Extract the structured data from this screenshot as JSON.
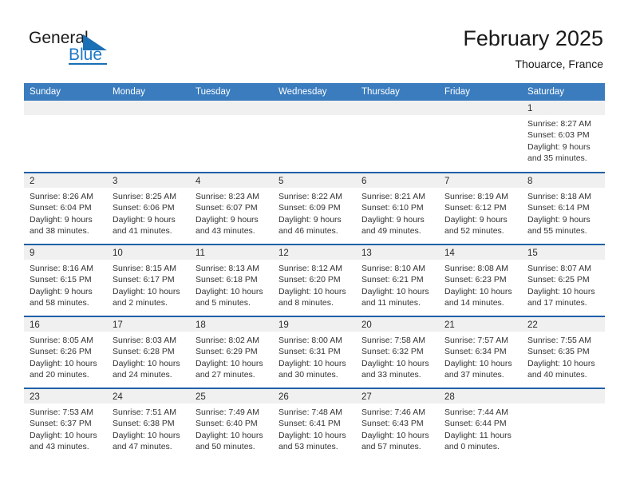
{
  "brand": {
    "name_part1": "General",
    "name_part2": "Blue",
    "accent_color": "#1A6FB5"
  },
  "header": {
    "title": "February 2025",
    "subtitle": "Thouarce, France"
  },
  "theme": {
    "header_blue": "#3A7CBE",
    "divider_blue": "#1F60A8",
    "day_band_gray": "#F0F0F0"
  },
  "calendar": {
    "weekdays": [
      "Sunday",
      "Monday",
      "Tuesday",
      "Wednesday",
      "Thursday",
      "Friday",
      "Saturday"
    ],
    "weeks": [
      [
        {
          "day": "",
          "lines": []
        },
        {
          "day": "",
          "lines": []
        },
        {
          "day": "",
          "lines": []
        },
        {
          "day": "",
          "lines": []
        },
        {
          "day": "",
          "lines": []
        },
        {
          "day": "",
          "lines": []
        },
        {
          "day": "1",
          "lines": [
            "Sunrise: 8:27 AM",
            "Sunset: 6:03 PM",
            "Daylight: 9 hours",
            "and 35 minutes."
          ]
        }
      ],
      [
        {
          "day": "2",
          "lines": [
            "Sunrise: 8:26 AM",
            "Sunset: 6:04 PM",
            "Daylight: 9 hours",
            "and 38 minutes."
          ]
        },
        {
          "day": "3",
          "lines": [
            "Sunrise: 8:25 AM",
            "Sunset: 6:06 PM",
            "Daylight: 9 hours",
            "and 41 minutes."
          ]
        },
        {
          "day": "4",
          "lines": [
            "Sunrise: 8:23 AM",
            "Sunset: 6:07 PM",
            "Daylight: 9 hours",
            "and 43 minutes."
          ]
        },
        {
          "day": "5",
          "lines": [
            "Sunrise: 8:22 AM",
            "Sunset: 6:09 PM",
            "Daylight: 9 hours",
            "and 46 minutes."
          ]
        },
        {
          "day": "6",
          "lines": [
            "Sunrise: 8:21 AM",
            "Sunset: 6:10 PM",
            "Daylight: 9 hours",
            "and 49 minutes."
          ]
        },
        {
          "day": "7",
          "lines": [
            "Sunrise: 8:19 AM",
            "Sunset: 6:12 PM",
            "Daylight: 9 hours",
            "and 52 minutes."
          ]
        },
        {
          "day": "8",
          "lines": [
            "Sunrise: 8:18 AM",
            "Sunset: 6:14 PM",
            "Daylight: 9 hours",
            "and 55 minutes."
          ]
        }
      ],
      [
        {
          "day": "9",
          "lines": [
            "Sunrise: 8:16 AM",
            "Sunset: 6:15 PM",
            "Daylight: 9 hours",
            "and 58 minutes."
          ]
        },
        {
          "day": "10",
          "lines": [
            "Sunrise: 8:15 AM",
            "Sunset: 6:17 PM",
            "Daylight: 10 hours",
            "and 2 minutes."
          ]
        },
        {
          "day": "11",
          "lines": [
            "Sunrise: 8:13 AM",
            "Sunset: 6:18 PM",
            "Daylight: 10 hours",
            "and 5 minutes."
          ]
        },
        {
          "day": "12",
          "lines": [
            "Sunrise: 8:12 AM",
            "Sunset: 6:20 PM",
            "Daylight: 10 hours",
            "and 8 minutes."
          ]
        },
        {
          "day": "13",
          "lines": [
            "Sunrise: 8:10 AM",
            "Sunset: 6:21 PM",
            "Daylight: 10 hours",
            "and 11 minutes."
          ]
        },
        {
          "day": "14",
          "lines": [
            "Sunrise: 8:08 AM",
            "Sunset: 6:23 PM",
            "Daylight: 10 hours",
            "and 14 minutes."
          ]
        },
        {
          "day": "15",
          "lines": [
            "Sunrise: 8:07 AM",
            "Sunset: 6:25 PM",
            "Daylight: 10 hours",
            "and 17 minutes."
          ]
        }
      ],
      [
        {
          "day": "16",
          "lines": [
            "Sunrise: 8:05 AM",
            "Sunset: 6:26 PM",
            "Daylight: 10 hours",
            "and 20 minutes."
          ]
        },
        {
          "day": "17",
          "lines": [
            "Sunrise: 8:03 AM",
            "Sunset: 6:28 PM",
            "Daylight: 10 hours",
            "and 24 minutes."
          ]
        },
        {
          "day": "18",
          "lines": [
            "Sunrise: 8:02 AM",
            "Sunset: 6:29 PM",
            "Daylight: 10 hours",
            "and 27 minutes."
          ]
        },
        {
          "day": "19",
          "lines": [
            "Sunrise: 8:00 AM",
            "Sunset: 6:31 PM",
            "Daylight: 10 hours",
            "and 30 minutes."
          ]
        },
        {
          "day": "20",
          "lines": [
            "Sunrise: 7:58 AM",
            "Sunset: 6:32 PM",
            "Daylight: 10 hours",
            "and 33 minutes."
          ]
        },
        {
          "day": "21",
          "lines": [
            "Sunrise: 7:57 AM",
            "Sunset: 6:34 PM",
            "Daylight: 10 hours",
            "and 37 minutes."
          ]
        },
        {
          "day": "22",
          "lines": [
            "Sunrise: 7:55 AM",
            "Sunset: 6:35 PM",
            "Daylight: 10 hours",
            "and 40 minutes."
          ]
        }
      ],
      [
        {
          "day": "23",
          "lines": [
            "Sunrise: 7:53 AM",
            "Sunset: 6:37 PM",
            "Daylight: 10 hours",
            "and 43 minutes."
          ]
        },
        {
          "day": "24",
          "lines": [
            "Sunrise: 7:51 AM",
            "Sunset: 6:38 PM",
            "Daylight: 10 hours",
            "and 47 minutes."
          ]
        },
        {
          "day": "25",
          "lines": [
            "Sunrise: 7:49 AM",
            "Sunset: 6:40 PM",
            "Daylight: 10 hours",
            "and 50 minutes."
          ]
        },
        {
          "day": "26",
          "lines": [
            "Sunrise: 7:48 AM",
            "Sunset: 6:41 PM",
            "Daylight: 10 hours",
            "and 53 minutes."
          ]
        },
        {
          "day": "27",
          "lines": [
            "Sunrise: 7:46 AM",
            "Sunset: 6:43 PM",
            "Daylight: 10 hours",
            "and 57 minutes."
          ]
        },
        {
          "day": "28",
          "lines": [
            "Sunrise: 7:44 AM",
            "Sunset: 6:44 PM",
            "Daylight: 11 hours",
            "and 0 minutes."
          ]
        },
        {
          "day": "",
          "lines": []
        }
      ]
    ]
  }
}
